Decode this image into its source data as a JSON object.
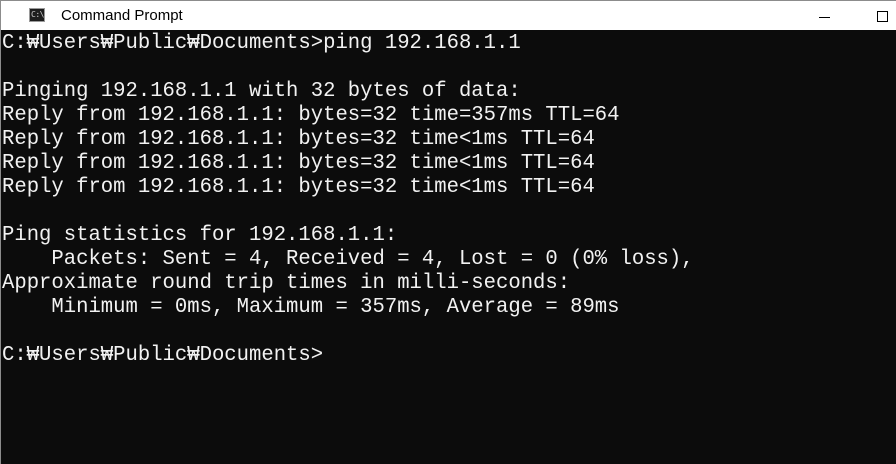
{
  "window": {
    "title": "Command Prompt",
    "icon": "cmd-icon",
    "icon_glyph": "C:\\"
  },
  "titlebar_buttons": {
    "minimize_icon": "minimize-icon",
    "maximize_icon": "maximize-icon"
  },
  "colors": {
    "console_bg": "#0c0c0c",
    "console_text": "#f2f2f2",
    "titlebar_bg": "#ffffff"
  },
  "console": {
    "lines": [
      "C:₩Users₩Public₩Documents>ping 192.168.1.1",
      "",
      "Pinging 192.168.1.1 with 32 bytes of data:",
      "Reply from 192.168.1.1: bytes=32 time=357ms TTL=64",
      "Reply from 192.168.1.1: bytes=32 time<1ms TTL=64",
      "Reply from 192.168.1.1: bytes=32 time<1ms TTL=64",
      "Reply from 192.168.1.1: bytes=32 time<1ms TTL=64",
      "",
      "Ping statistics for 192.168.1.1:",
      "    Packets: Sent = 4, Received = 4, Lost = 0 (0% loss),",
      "Approximate round trip times in milli-seconds:",
      "    Minimum = 0ms, Maximum = 357ms, Average = 89ms",
      "",
      "C:₩Users₩Public₩Documents>"
    ]
  }
}
